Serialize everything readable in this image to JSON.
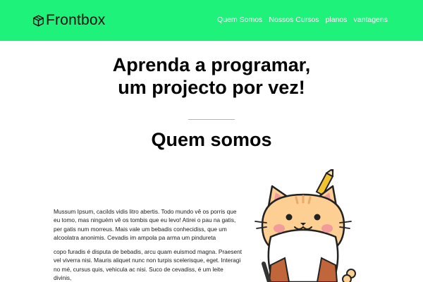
{
  "brand": {
    "name": "Frontbox",
    "icon": "box-icon"
  },
  "nav": {
    "items": [
      {
        "label": "Quem Somos"
      },
      {
        "label": "Nossos Cursos"
      },
      {
        "label": "planos"
      },
      {
        "label": "vantagens"
      }
    ]
  },
  "hero": {
    "title_line1": "Aprenda a programar,",
    "title_line2": "um projecto por vez!"
  },
  "about": {
    "title": "Quem somos",
    "paragraph1": "Mussum Ipsum, cacilds vidis litro abertis. Todo mundo vê os porris que eu tomo, mas ninguém vê os tombis que eu levo! Atirei o pau na gatis, per gatis num morreus. Mais vale um bebadis conhecidiss, que um alcoolatra anonimis. Cevadis im ampola pa arma um pindureta",
    "paragraph2": "copo furadis é disputa de bebadis, arcu quam euismod magna. Praesent vel viverra nisi. Mauris aliquet nunc non turpis scelerisque, eget. Interagi no mé, cursus quis, vehicula ac nisi. Suco de cevadiss, é um leite divinis,"
  },
  "colors": {
    "navbar_bg": "#1ef27a",
    "divider": "#e88ee8",
    "mascot_fur": "#fdcf92",
    "mascot_cheeks": "#f39b9b"
  }
}
